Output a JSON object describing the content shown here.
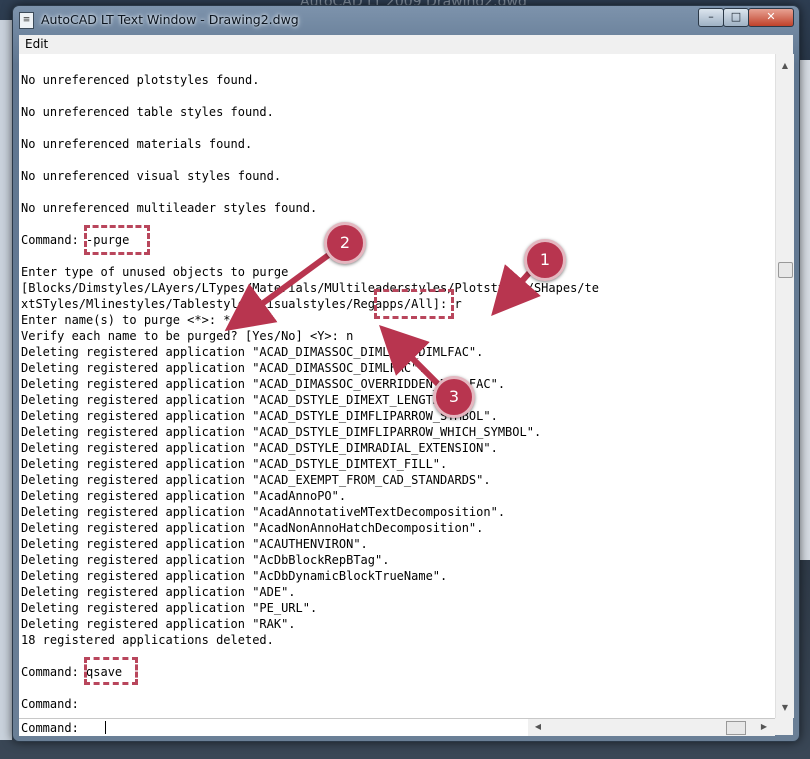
{
  "window": {
    "title": "AutoCAD LT Text Window - Drawing2.dwg",
    "icon": "text-window-icon",
    "controls": {
      "minimize": "–",
      "maximize": "□",
      "close": "✕"
    }
  },
  "background": {
    "app_title": "AutoCAD LT 2009 Drawing2.dwg"
  },
  "menu": {
    "edit": "Edit"
  },
  "lines": [
    "No unreferenced plotstyles found.",
    "No unreferenced table styles found.",
    "No unreferenced materials found.",
    "No unreferenced visual styles found.",
    "No unreferenced multileader styles found.",
    "Command: -purge",
    "Enter type of unused objects to purge",
    "[Blocks/Dimstyles/LAyers/LTypes/Materials/MUltileaderstyles/Plotstyles/SHapes/te",
    "xtSTyles/Mlinestyles/Tablestyles/Visualstyles/Regapps/All]: r",
    "Enter name(s) to purge <*>: *",
    "Verify each name to be purged? [Yes/No] <Y>: n",
    "Deleting registered application \"ACAD_DIMASSOC_DIMLFAC_DIMLFAC\".",
    "Deleting registered application \"ACAD_DIMASSOC_DIMLFAC\".",
    "Deleting registered application \"ACAD_DIMASSOC_OVERRIDDEN_DIMLFAC\".",
    "Deleting registered application \"ACAD_DSTYLE_DIMEXT_LENGTH\".",
    "Deleting registered application \"ACAD_DSTYLE_DIMFLIPARROW_SYMBOL\".",
    "Deleting registered application \"ACAD_DSTYLE_DIMFLIPARROW_WHICH_SYMBOL\".",
    "Deleting registered application \"ACAD_DSTYLE_DIMRADIAL_EXTENSION\".",
    "Deleting registered application \"ACAD_DSTYLE_DIMTEXT_FILL\".",
    "Deleting registered application \"ACAD_EXEMPT_FROM_CAD_STANDARDS\".",
    "Deleting registered application \"AcadAnnoPO\".",
    "Deleting registered application \"AcadAnnotativeMTextDecomposition\".",
    "Deleting registered application \"AcadNonAnnoHatchDecomposition\".",
    "Deleting registered application \"ACAUTHENVIRON\".",
    "Deleting registered application \"AcDbBlockRepBTag\".",
    "Deleting registered application \"AcDbDynamicBlockTrueName\".",
    "Deleting registered application \"ADE\".",
    "Deleting registered application \"PE_URL\".",
    "Deleting registered application \"RAK\".",
    "18 registered applications deleted.",
    "Command: qsave",
    "Command:"
  ],
  "input": {
    "prompt": "Command:"
  },
  "annotations": {
    "badge_1": "1",
    "badge_2": "2",
    "badge_3": "3"
  },
  "colors": {
    "annotation": "#b8354f",
    "highlight": "#b9465c"
  }
}
